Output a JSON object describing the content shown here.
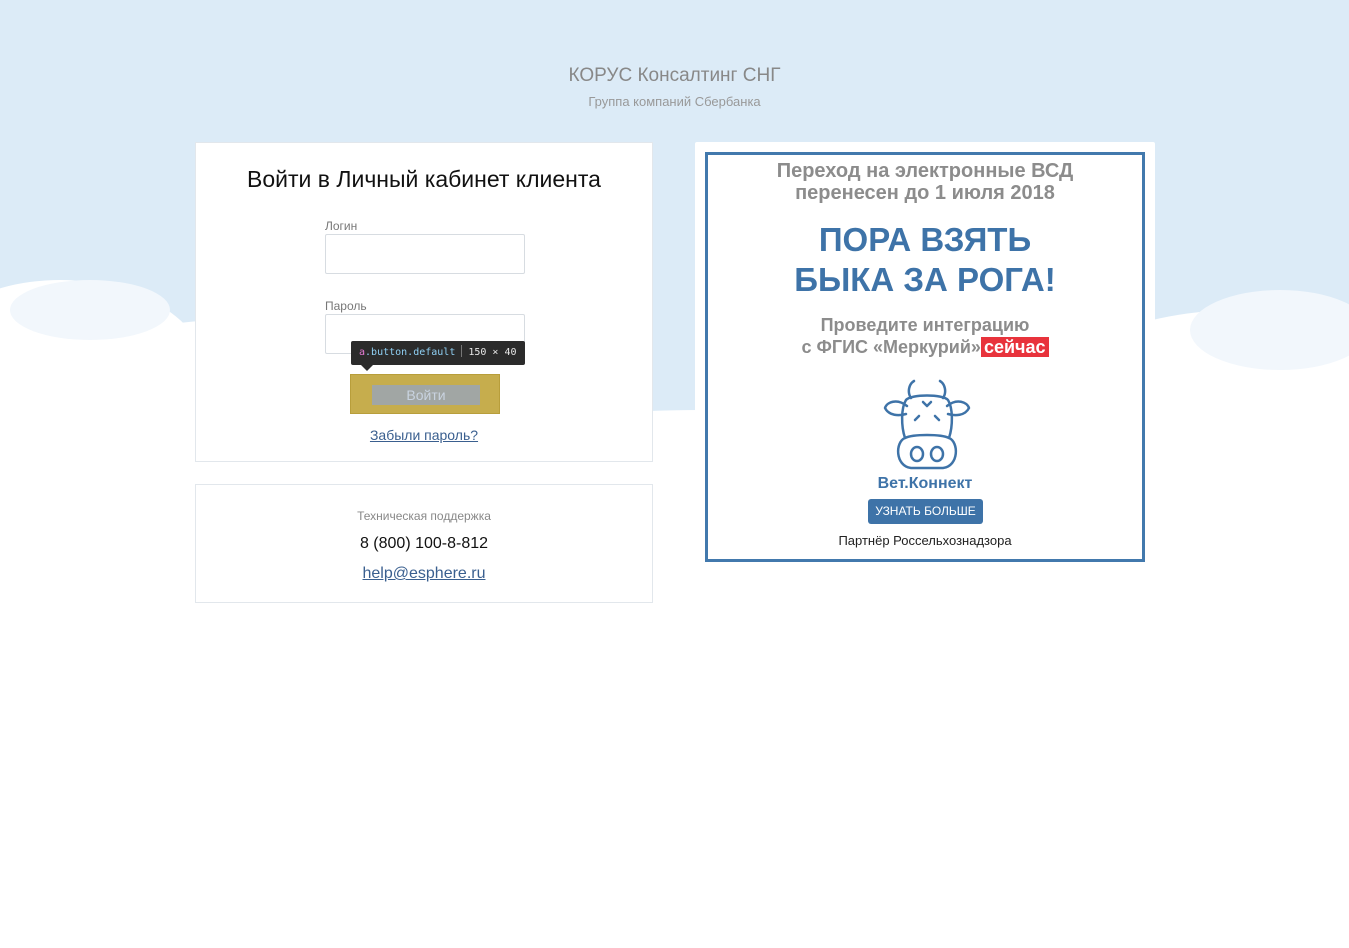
{
  "header": {
    "company_name": "КОРУС Консалтинг СНГ",
    "company_sub": "Группа компаний Сбербанка"
  },
  "login": {
    "title": "Войти в Личный кабинет клиента",
    "login_label": "Логин",
    "login_value": "",
    "password_label": "Пароль",
    "password_value": "",
    "button_label": "Войти",
    "forgot_label": "Забыли пароль?"
  },
  "devtools_tooltip": {
    "tag": "a",
    "classes": ".button.default",
    "size": "150 × 40"
  },
  "support": {
    "label": "Техническая поддержка",
    "phone": "8 (800) 100-8-812",
    "email": "help@esphere.ru"
  },
  "ad": {
    "line1": "Переход на электронные ВСД",
    "line2": "перенесен до 1 июля 2018",
    "headline1": "ПОРА ВЗЯТЬ",
    "headline2": "БЫКА ЗА РОГА!",
    "text1": "Проведите интеграцию",
    "text2": "с ФГИС «Меркурий»",
    "text2_highlight": "сейчас",
    "brand": "Вет.Коннект",
    "button_label": "УЗНАТЬ БОЛЬШЕ",
    "partner": "Партнёр Россельхознадзора",
    "icon": "cow-logo-icon"
  },
  "colors": {
    "sky": "#dcebf7",
    "button_gold": "#c6ad4d",
    "link": "#3a5f8f",
    "ad_blue": "#3e73a8",
    "ad_red": "#e8333c"
  }
}
